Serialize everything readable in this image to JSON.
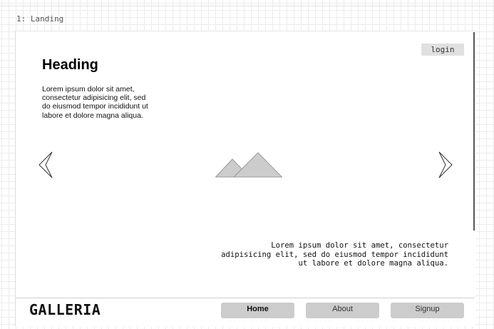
{
  "frame": {
    "label": "1: Landing"
  },
  "header": {
    "login_label": "login"
  },
  "hero": {
    "heading": "Heading",
    "intro": "Lorem ipsum dolor sit amet, consectetur adipisicing elit, sed do eiusmod tempor incididunt ut labore et dolore magna aliqua.",
    "caption": "Lorem ipsum dolor sit amet, consectetur adipisicing elit, sed do eiusmod tempor incididunt ut labore et dolore magna aliqua.",
    "prev_icon": "chevron-left-icon",
    "next_icon": "chevron-right-icon",
    "image_icon": "image-placeholder-icon"
  },
  "footer": {
    "logo": "GALLERIA",
    "nav": [
      {
        "label": "Home",
        "active": true
      },
      {
        "label": "About",
        "active": false
      },
      {
        "label": "Signup",
        "active": false
      }
    ]
  },
  "colors": {
    "grid": "#ececec",
    "button_fill": "#cccccc",
    "login_fill": "#e0e0e0",
    "placeholder_fill": "#cccccc",
    "placeholder_stroke": "#999999"
  }
}
